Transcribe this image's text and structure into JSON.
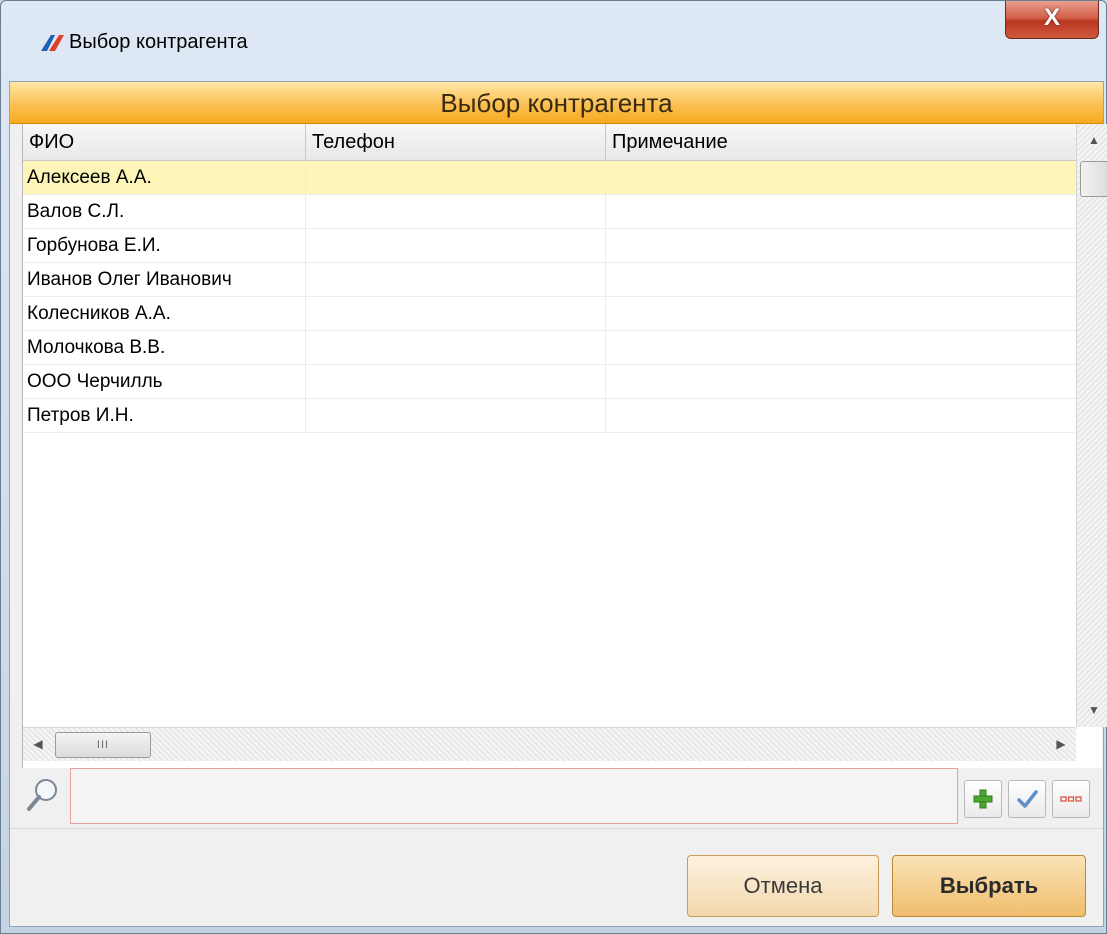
{
  "window": {
    "title": "Выбор контрагента",
    "close_label": "X"
  },
  "header": {
    "title": "Выбор контрагента"
  },
  "table": {
    "columns": [
      "ФИО",
      "Телефон",
      "Примечание"
    ],
    "rows": [
      [
        "Алексеев А.А.",
        "",
        ""
      ],
      [
        "Валов С.Л.",
        "",
        ""
      ],
      [
        "Горбунова Е.И.",
        "",
        ""
      ],
      [
        "Иванов Олег Иванович",
        "",
        ""
      ],
      [
        "Колесников А.А.",
        "",
        ""
      ],
      [
        "Молочкова В.В.",
        "",
        ""
      ],
      [
        "ООО Черчилль",
        "",
        ""
      ],
      [
        "Петров И.Н.",
        "",
        ""
      ]
    ],
    "selected_row": 0
  },
  "scrollbars": {
    "h_thumb_grip": "III"
  },
  "search": {
    "value": ""
  },
  "footer": {
    "cancel_label": "Отмена",
    "select_label": "Выбрать"
  },
  "colors": {
    "header_band": "#f7a91e",
    "selected_row": "#fdf6b8",
    "close_button": "#c94a30"
  }
}
